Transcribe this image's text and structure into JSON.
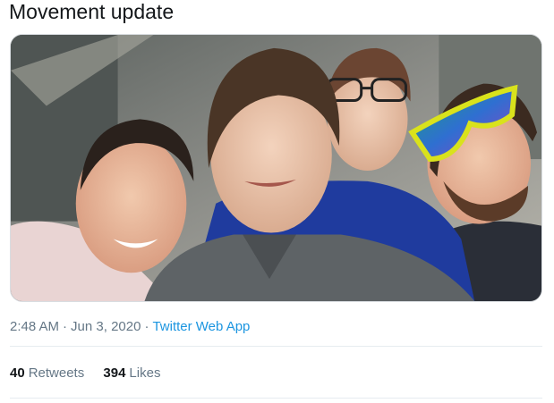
{
  "tweet": {
    "text": "Movement update"
  },
  "media": {
    "kind": "photo",
    "subjects": 4
  },
  "meta": {
    "time": "2:48 AM",
    "separator": "·",
    "date": "Jun 3, 2020",
    "source": "Twitter Web App"
  },
  "stats": {
    "retweets_count": "40",
    "retweets_label": "Retweets",
    "likes_count": "394",
    "likes_label": "Likes"
  },
  "colors": {
    "text": "#14171a",
    "muted": "#657786",
    "link": "#1b95e0",
    "divider": "#e6ecf0"
  }
}
